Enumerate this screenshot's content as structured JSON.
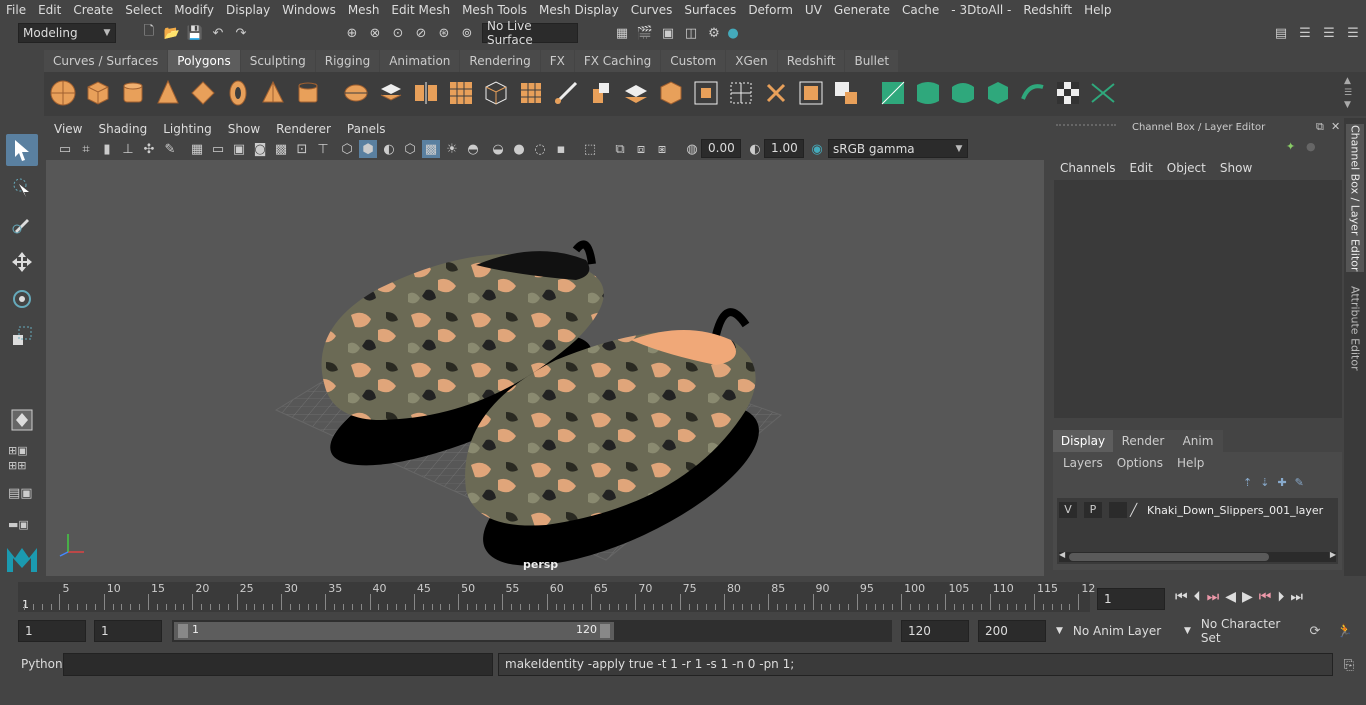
{
  "menu": [
    "File",
    "Edit",
    "Create",
    "Select",
    "Modify",
    "Display",
    "Windows",
    "Mesh",
    "Edit Mesh",
    "Mesh Tools",
    "Mesh Display",
    "Curves",
    "Surfaces",
    "Deform",
    "UV",
    "Generate",
    "Cache",
    "- 3DtoAll -",
    "Redshift",
    "Help"
  ],
  "workspace": "Modeling",
  "live_surface": "No Live Surface",
  "shelf_tabs": [
    "Curves / Surfaces",
    "Polygons",
    "Sculpting",
    "Rigging",
    "Animation",
    "Rendering",
    "FX",
    "FX Caching",
    "Custom",
    "XGen",
    "Redshift",
    "Bullet"
  ],
  "shelf_active": "Polygons",
  "viewport_menu": [
    "View",
    "Shading",
    "Lighting",
    "Show",
    "Renderer",
    "Panels"
  ],
  "viewport": {
    "exposure": "0.00",
    "gamma": "1.00",
    "color_space": "sRGB gamma",
    "camera": "persp"
  },
  "channel_box": {
    "title": "Channel Box / Layer Editor",
    "menu": [
      "Channels",
      "Edit",
      "Object",
      "Show"
    ]
  },
  "layer_tabs": [
    "Display",
    "Render",
    "Anim"
  ],
  "layer_menu": [
    "Layers",
    "Options",
    "Help"
  ],
  "layer": {
    "v": "V",
    "p": "P",
    "name": "Khaki_Down_Slippers_001_layer"
  },
  "side_tabs": [
    "Channel Box / Layer Editor",
    "Attribute Editor"
  ],
  "timeline_ticks": [
    "5",
    "10",
    "15",
    "20",
    "25",
    "30",
    "35",
    "40",
    "45",
    "50",
    "55",
    "60",
    "65",
    "70",
    "75",
    "80",
    "85",
    "90",
    "95",
    "100",
    "105",
    "110",
    "115",
    "12"
  ],
  "timeline_start": "1",
  "current_frame": "1",
  "range": {
    "start": "1",
    "start2": "1",
    "slider_start": "1",
    "slider_end": "120",
    "end": "120",
    "end2": "200"
  },
  "anim_layer": "No Anim Layer",
  "char_set": "No Character Set",
  "cmd": {
    "lang": "Python",
    "output": "makeIdentity -apply true -t 1 -r 1 -s 1 -n 0 -pn 1;"
  }
}
